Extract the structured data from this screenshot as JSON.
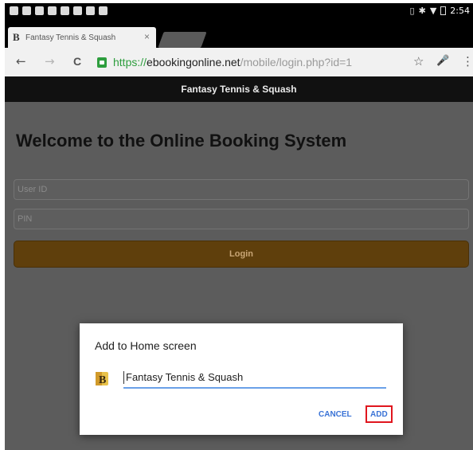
{
  "status_bar": {
    "time": "2:54"
  },
  "tab": {
    "favicon_letter": "B",
    "title": "Fantasy Tennis & Squash",
    "close": "×"
  },
  "toolbar": {
    "back": "←",
    "forward": "→",
    "reload": "C",
    "url_scheme": "https://",
    "url_domain": "ebookingonline.net",
    "url_path": "/mobile/login.php?id=1",
    "bookmark": "☆",
    "mic": "🎤",
    "menu": "⋮"
  },
  "page": {
    "header": "Fantasy Tennis & Squash",
    "heading": "Welcome to the Online Booking System",
    "user_id_placeholder": "User ID",
    "pin_placeholder": "PIN",
    "login_label": "Login"
  },
  "dialog": {
    "title": "Add to Home screen",
    "icon_letter": "B",
    "name_value": "Fantasy Tennis & Squash",
    "cancel_label": "CANCEL",
    "add_label": "ADD"
  },
  "colors": {
    "url_green": "#2e9e3e",
    "login_brown": "#5f3f0c",
    "dialog_action_blue": "#3a73d6",
    "highlight_red": "#e0161e"
  }
}
